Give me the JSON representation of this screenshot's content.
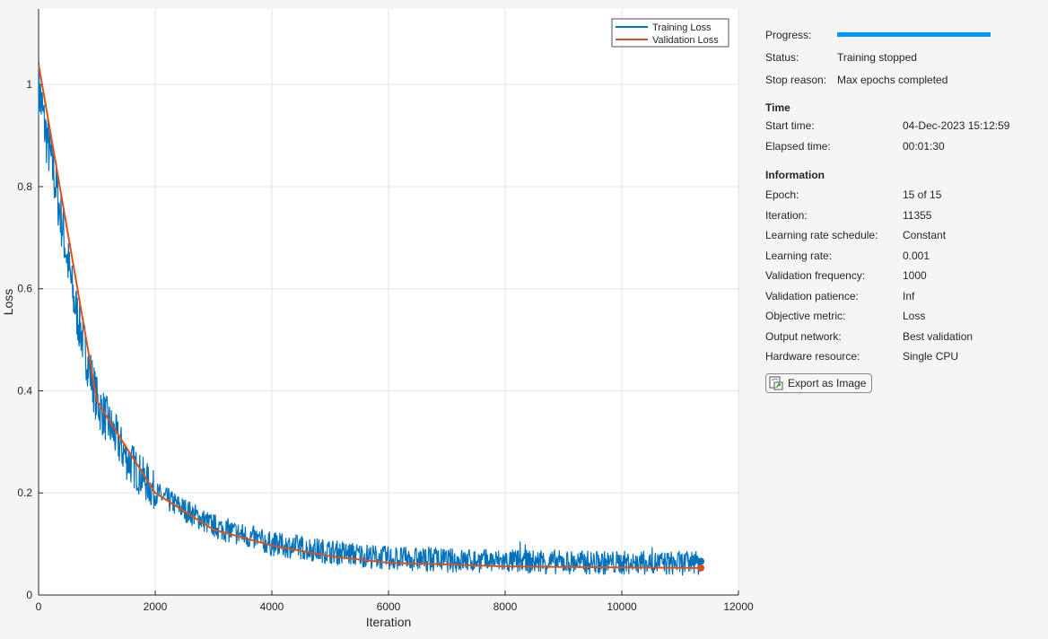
{
  "chart_data": {
    "type": "line",
    "xlabel": "Iteration",
    "ylabel": "Loss",
    "xlim": [
      0,
      12000
    ],
    "ylim": [
      0,
      1.148
    ],
    "xticks": [
      0,
      2000,
      4000,
      6000,
      8000,
      10000,
      12000
    ],
    "xtick_labels": [
      "0",
      "2000",
      "4000",
      "6000",
      "8000",
      "10000",
      "12000"
    ],
    "yticks": [
      0,
      0.2,
      0.4,
      0.6,
      0.8,
      1
    ],
    "ytick_labels": [
      "0",
      "0.2",
      "0.4",
      "0.6",
      "0.8",
      "1"
    ],
    "grid": true,
    "legend_position": "top-right",
    "series": [
      {
        "name": "Training Loss",
        "color": "#0072bd",
        "noisy": true,
        "trend_x": [
          0,
          100,
          300,
          600,
          1000,
          1500,
          2000,
          3000,
          4000,
          5000,
          6000,
          7000,
          8000,
          9000,
          10000,
          11355
        ],
        "trend_y": [
          1.0,
          0.92,
          0.8,
          0.58,
          0.38,
          0.27,
          0.2,
          0.135,
          0.1,
          0.085,
          0.072,
          0.068,
          0.066,
          0.064,
          0.063,
          0.062
        ]
      },
      {
        "name": "Validation Loss",
        "color": "#d95319",
        "x": [
          0,
          1000,
          2000,
          3000,
          4000,
          5000,
          6000,
          7000,
          8000,
          9000,
          10000,
          11355
        ],
        "y": [
          1.04,
          0.38,
          0.2,
          0.128,
          0.097,
          0.076,
          0.063,
          0.06,
          0.056,
          0.055,
          0.054,
          0.053
        ]
      }
    ]
  },
  "panel": {
    "progress_label": "Progress:",
    "progress": 1.0,
    "status_label": "Status:",
    "status": "Training stopped",
    "stop_label": "Stop reason:",
    "stop": "Max epochs completed",
    "time_heading": "Time",
    "time": [
      {
        "label": "Start time:",
        "value": "04-Dec-2023 15:12:59"
      },
      {
        "label": "Elapsed time:",
        "value": "00:01:30"
      }
    ],
    "info_heading": "Information",
    "info": [
      {
        "label": "Epoch:",
        "value": "15 of 15"
      },
      {
        "label": "Iteration:",
        "value": "11355"
      },
      {
        "label": "Learning rate schedule:",
        "value": "Constant"
      },
      {
        "label": "Learning rate:",
        "value": "0.001"
      },
      {
        "label": "Validation frequency:",
        "value": "1000"
      },
      {
        "label": "Validation patience:",
        "value": "Inf"
      },
      {
        "label": "Objective metric:",
        "value": "Loss"
      },
      {
        "label": "Output network:",
        "value": "Best validation"
      },
      {
        "label": "Hardware resource:",
        "value": "Single CPU"
      }
    ],
    "export_label": "Export as Image"
  }
}
